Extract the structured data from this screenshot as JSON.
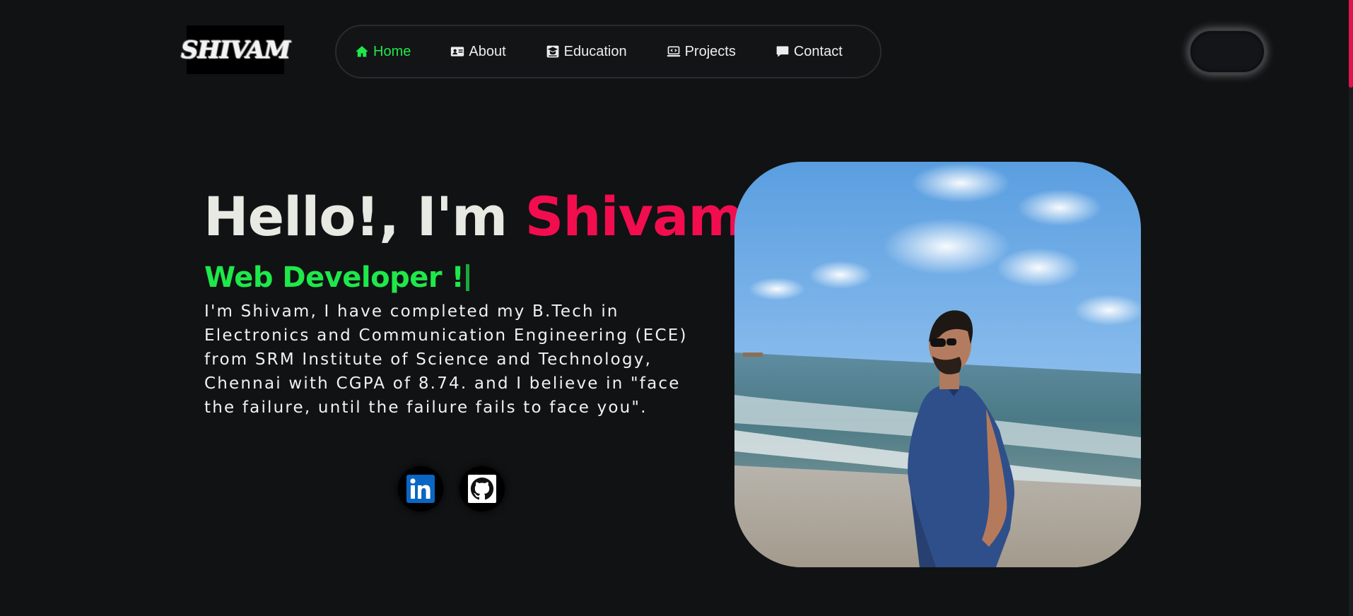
{
  "logo": {
    "text": "SHIVAM"
  },
  "nav": {
    "items": [
      {
        "label": "Home",
        "icon": "home-icon",
        "active": true
      },
      {
        "label": "About",
        "icon": "id-card-icon",
        "active": false
      },
      {
        "label": "Education",
        "icon": "graduation-icon",
        "active": false
      },
      {
        "label": "Projects",
        "icon": "laptop-code-icon",
        "active": false
      },
      {
        "label": "Contact",
        "icon": "message-icon",
        "active": false
      }
    ]
  },
  "theme_toggle": {
    "icon": "moon-icon"
  },
  "hero": {
    "greeting": "Hello!, I'm ",
    "name": "Shivam",
    "role": "Web Developer !",
    "description": "I'm Shivam, I have completed my B.Tech in Electronics and Communication Engineering (ECE) from SRM Institute of Science and Technology, Chennai with CGPA of 8.74. and I believe in \"face the failure, until the failure fails to face you\".",
    "social": [
      {
        "name": "linkedin-icon"
      },
      {
        "name": "github-icon"
      }
    ]
  },
  "colors": {
    "background": "#111214",
    "accent_green": "#1ee84a",
    "accent_pink": "#f20d4f",
    "text": "#e8e9e2"
  }
}
